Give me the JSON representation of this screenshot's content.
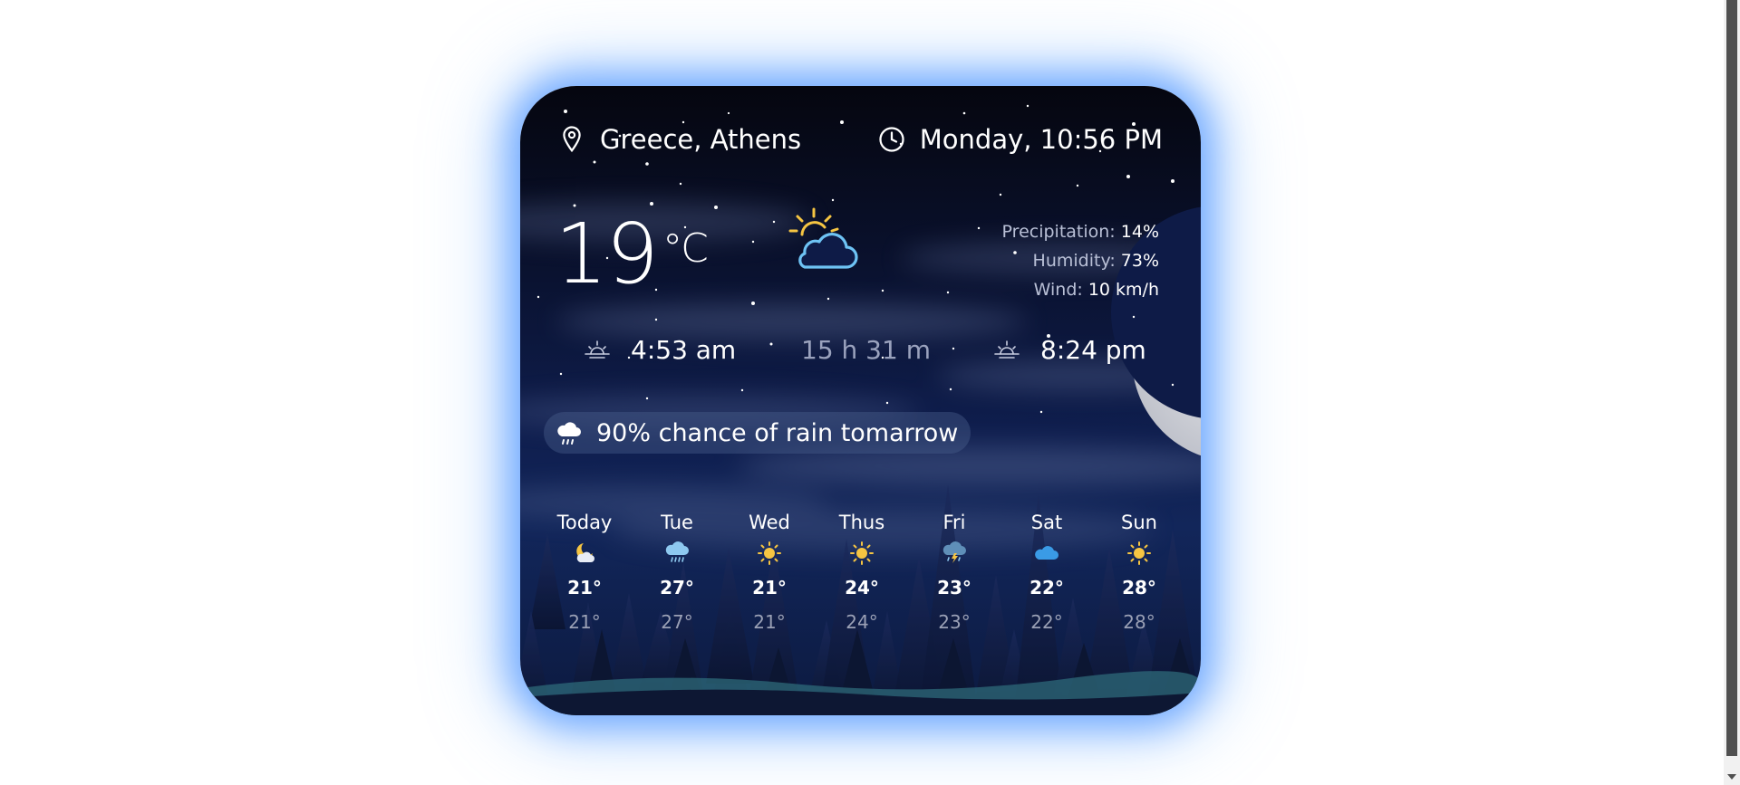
{
  "location": "Greece, Athens",
  "datetime": "Monday, 10:56 PM",
  "current": {
    "temperature": "19",
    "unit": "°C",
    "condition_icon": "partly-cloudy-day-icon"
  },
  "stats": {
    "precipitation_label": "Precipitation:",
    "precipitation_value": "14%",
    "humidity_label": "Humidity:",
    "humidity_value": "73%",
    "wind_label": "Wind:",
    "wind_value": "10 km/h"
  },
  "sun": {
    "sunrise": "4:53 am",
    "day_length": "15 h 31 m",
    "sunset": "8:24 pm"
  },
  "rain_notice": "90% chance of rain tomarrow",
  "forecast": [
    {
      "day": "Today",
      "icon": "moon-cloud-icon",
      "high": "21°",
      "low": "21°"
    },
    {
      "day": "Tue",
      "icon": "rain-cloud-icon",
      "high": "27°",
      "low": "27°"
    },
    {
      "day": "Wed",
      "icon": "sun-icon",
      "high": "21°",
      "low": "21°"
    },
    {
      "day": "Thus",
      "icon": "sun-icon",
      "high": "24°",
      "low": "24°"
    },
    {
      "day": "Fri",
      "icon": "thunderstorm-icon",
      "high": "23°",
      "low": "23°"
    },
    {
      "day": "Sat",
      "icon": "cloud-icon",
      "high": "22°",
      "low": "22°"
    },
    {
      "day": "Sun",
      "icon": "sun-icon",
      "high": "28°",
      "low": "28°"
    }
  ],
  "colors": {
    "glow": "#5096ff",
    "sun_yellow": "#f6c542",
    "cloud_blue": "#6ec3f4"
  }
}
